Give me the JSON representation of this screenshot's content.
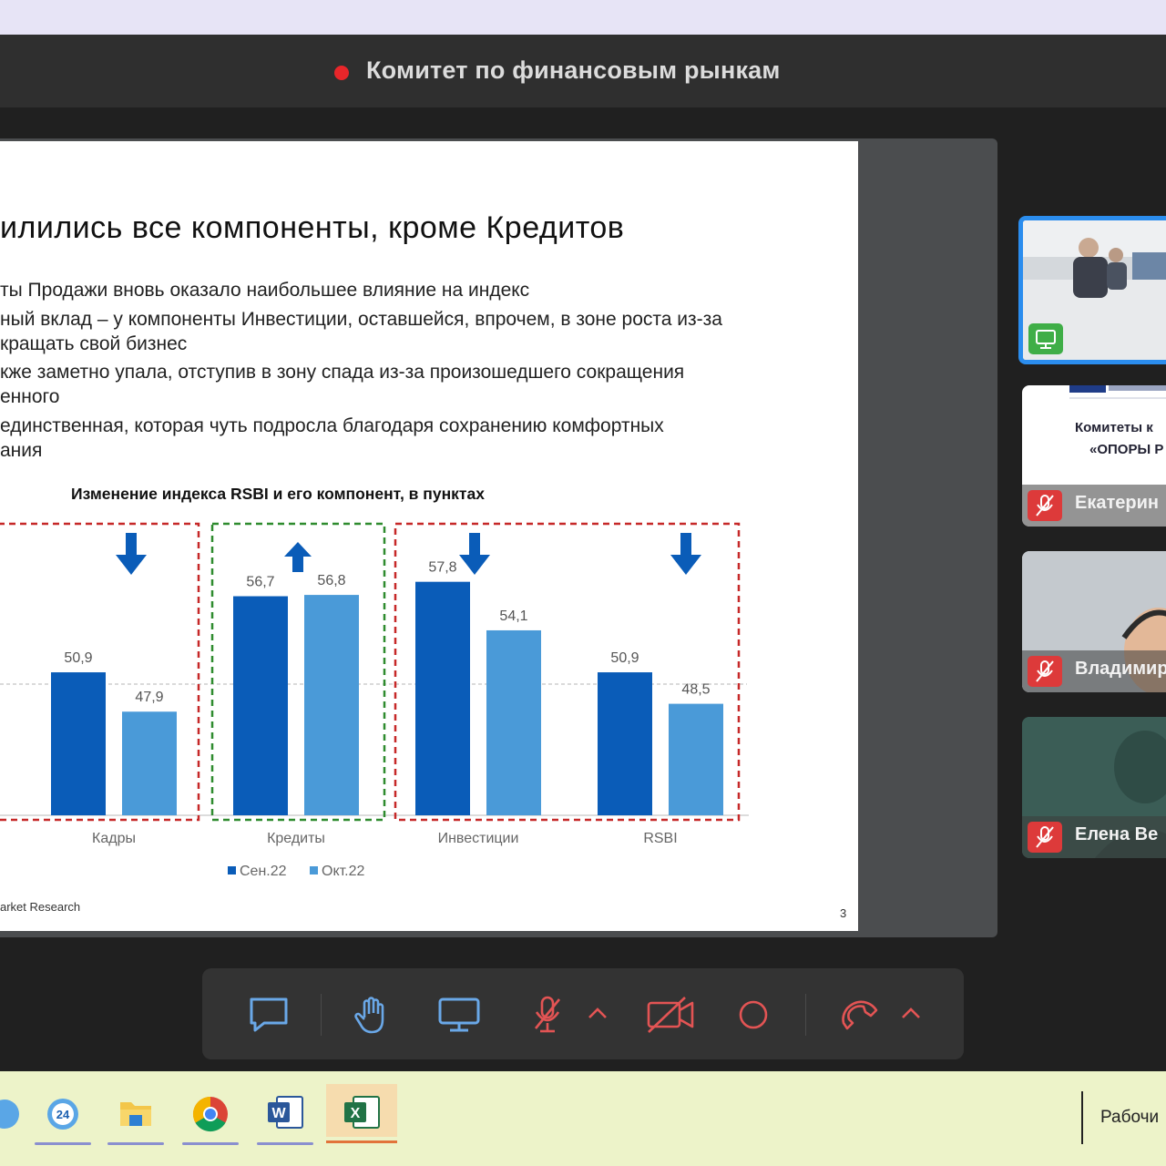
{
  "meeting": {
    "title": "Комитет по финансовым рынкам"
  },
  "slide": {
    "title": "илились все компоненты, кроме Кредитов",
    "bullets": [
      "ты Продажи вновь оказало наибольшее влияние на индекс",
      "ный вклад – у компоненты Инвестиции, оставшейся, впрочем, в зоне роста из-за",
      "кращать свой бизнес",
      "кже заметно упала, отступив в зону спада из-за произошедшего сокращения",
      "енного",
      "единственная, которая чуть подросла благодаря сохранению комфортных",
      "ания"
    ],
    "chart_title": "Изменение индекса RSBI и его компонент, в пунктах",
    "source": "arket Research",
    "page": "3"
  },
  "chart_data": {
    "type": "bar",
    "title": "Изменение индекса RSBI и его компонент, в пунктах",
    "categories": [
      "Кадры",
      "Кредиты",
      "Инвестиции",
      "RSBI"
    ],
    "series": [
      {
        "name": "Сен.22",
        "values": [
          50.9,
          56.7,
          57.8,
          50.9
        ],
        "labels": [
          "50,9",
          "56,7",
          "57,8",
          "50,9"
        ]
      },
      {
        "name": "Окт.22",
        "values": [
          47.9,
          56.8,
          54.1,
          48.5
        ],
        "labels": [
          "47,9",
          "56,8",
          "54,1",
          "48,5"
        ]
      }
    ],
    "direction": [
      "down",
      "up",
      "down",
      "down"
    ],
    "reference_line": 50,
    "colors": {
      "sep": "#0a5cb8",
      "oct": "#4a9ad8",
      "arrow": "#0a5cb8",
      "box_down": "#c62828",
      "box_up": "#2e8b2e"
    },
    "legend": "bottom"
  },
  "participants": [
    {
      "name": "",
      "state": "screen-share"
    },
    {
      "name": "Екатерин",
      "state": "mic-off",
      "preview_text": [
        "Комитеты к",
        "«ОПОРЫ Р"
      ]
    },
    {
      "name": "Владимир",
      "state": "mic-off"
    },
    {
      "name": "Елена Ве",
      "state": "mic-off"
    }
  ],
  "toolbar": {
    "items": [
      "chat-icon",
      "raise-hand-icon",
      "screen-share-icon",
      "mic-off-icon",
      "chevron-up-icon",
      "camera-off-icon",
      "record-icon",
      "hangup-icon",
      "chevron-up-icon"
    ],
    "danger_color": "#e35454",
    "icon_color": "#6aa8e8"
  },
  "taskbar": {
    "apps": [
      "app-icon",
      "24-app-icon",
      "file-explorer-icon",
      "chrome-icon",
      "word-icon",
      "excel-icon"
    ],
    "desktop_label": "Рабочи"
  }
}
